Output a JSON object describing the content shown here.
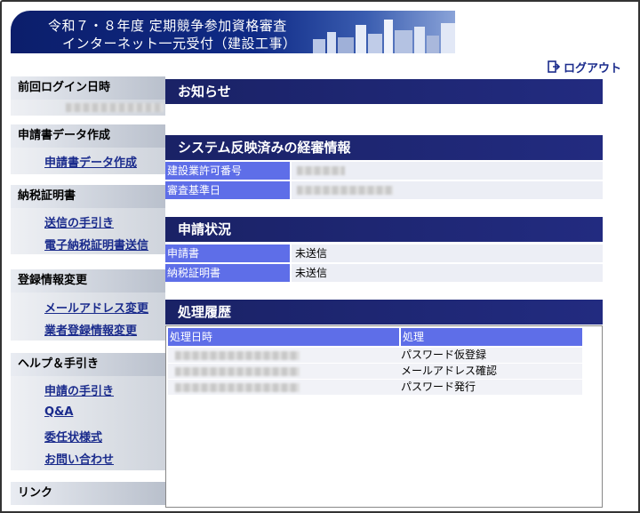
{
  "header": {
    "line1": "令和７・８年度 定期競争参加資格審査",
    "line2": "インターネット一元受付（建設工事）",
    "logout_label": "ログアウト",
    "logout_icon": "logout-icon",
    "skyline": "city-skyline-image"
  },
  "sidebar": {
    "last_login": {
      "title": "前回ログイン日時"
    },
    "sections": [
      {
        "title": "申請書データ作成",
        "links": [
          "申請書データ作成"
        ]
      },
      {
        "title": "納税証明書",
        "links": [
          "送信の手引き",
          "電子納税証明書送信"
        ]
      },
      {
        "title": "登録情報変更",
        "links": [
          "メールアドレス変更",
          "業者登録情報変更"
        ]
      },
      {
        "title": "ヘルプ＆手引き",
        "links": [
          "申請の手引き",
          "Q&A",
          "委任状様式",
          "お問い合わせ"
        ]
      },
      {
        "title": "リンク",
        "links": []
      }
    ]
  },
  "main": {
    "notice_title": "お知らせ",
    "keishin": {
      "title": "システム反映済みの経審情報",
      "rows": [
        {
          "label": "建設業許可番号"
        },
        {
          "label": "審査基準日"
        }
      ]
    },
    "status": {
      "title": "申請状況",
      "rows": [
        {
          "label": "申請書",
          "value": "未送信"
        },
        {
          "label": "納税証明書",
          "value": "未送信"
        }
      ]
    },
    "history": {
      "title": "処理履歴",
      "col_date": "処理日時",
      "col_action": "処理",
      "rows": [
        {
          "action": "パスワード仮登録"
        },
        {
          "action": "メールアドレス確認"
        },
        {
          "action": "パスワード発行"
        }
      ]
    }
  },
  "colors": {
    "bar": "#1a2266",
    "label_cell": "#5e6ee8",
    "link": "#1a2b8c"
  }
}
